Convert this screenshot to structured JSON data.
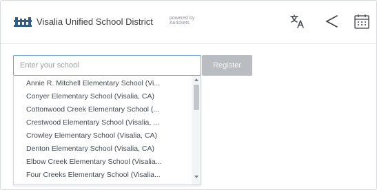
{
  "header": {
    "district_name": "Visalia Unified School District",
    "powered_by_line1": "powered by",
    "powered_by_line2": "Aurickets",
    "icons": [
      "district-logo-icon",
      "translate-icon",
      "share-icon",
      "calendar-icon"
    ]
  },
  "search": {
    "placeholder": "Enter your school",
    "value": "",
    "register_label": "Register"
  },
  "dropdown": {
    "items": [
      "Annie R. Mitchell Elementary School (Vi...",
      "Conyer Elementary School (Visalia, CA)",
      "Cottonwood Creek Elementary School (...",
      "Crestwood Elementary School (Visalia, ...",
      "Crowley Elementary School (Visalia, CA)",
      "Denton Elementary School (Visalia, CA)",
      "Elbow Creek Elementary School (Visalia...",
      "Four Creeks Elementary School (Visalia..."
    ]
  },
  "colors": {
    "input_border": "#6ea6dd",
    "register_bg": "#b9bcc0",
    "logo": "#2f5f86",
    "icon": "#3c4045"
  }
}
